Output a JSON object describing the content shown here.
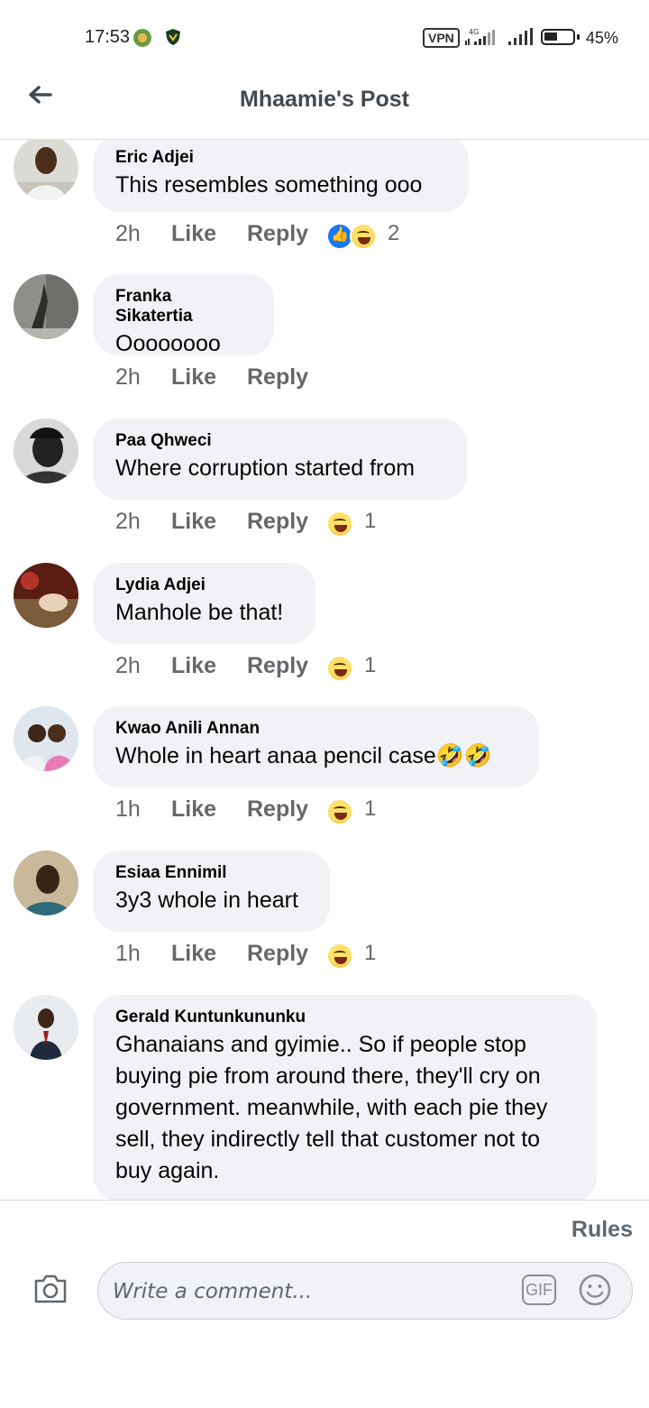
{
  "status_bar": {
    "time": "17:53",
    "vpn": "VPN",
    "network": "4G",
    "battery": "45%",
    "icons": [
      "notification-app-icon",
      "shield-app-icon",
      "vpn-icon",
      "signal-icon",
      "signal-icon",
      "battery-icon"
    ]
  },
  "header": {
    "title": "Mhaamie's Post",
    "back_icon": "arrow-left-icon"
  },
  "comments": [
    {
      "name": "Eric Adjei",
      "text": "This resembles something ooo",
      "time": "2h",
      "like": "Like",
      "reply": "Reply",
      "reactions": [
        "like",
        "haha"
      ],
      "reaction_count": "2"
    },
    {
      "name": "Franka Sikatertia",
      "text": "Oooooooo",
      "time": "2h",
      "like": "Like",
      "reply": "Reply",
      "reactions": [],
      "reaction_count": ""
    },
    {
      "name": "Paa Qhweci",
      "text": "Where corruption started from",
      "time": "2h",
      "like": "Like",
      "reply": "Reply",
      "reactions": [
        "haha"
      ],
      "reaction_count": "1"
    },
    {
      "name": "Lydia Adjei",
      "text": "Manhole be that!",
      "time": "2h",
      "like": "Like",
      "reply": "Reply",
      "reactions": [
        "haha"
      ],
      "reaction_count": "1"
    },
    {
      "name": "Kwao Anili Annan",
      "text": "Whole in heart anaa pencil case🤣🤣",
      "time": "1h",
      "like": "Like",
      "reply": "Reply",
      "reactions": [
        "haha"
      ],
      "reaction_count": "1"
    },
    {
      "name": "Esiaa Ennimil",
      "text": "3y3 whole in heart",
      "time": "1h",
      "like": "Like",
      "reply": "Reply",
      "reactions": [
        "haha"
      ],
      "reaction_count": "1"
    },
    {
      "name": "Gerald Kuntunkununku",
      "text": "Ghanaians and gyimie.. So if people stop buying pie from around there, they'll cry on government. meanwhile, with each pie they sell, they indirectly tell that customer not to buy again.",
      "time": "",
      "like": "",
      "reply": "",
      "reactions": [],
      "reaction_count": ""
    }
  ],
  "footer": {
    "rules": "Rules",
    "placeholder": "Write a comment...",
    "gif": "GIF",
    "camera_icon": "camera-icon",
    "emoji_icon": "smiley-icon"
  },
  "colors": {
    "bubble": "#f0f2f5",
    "secondary_text": "#65676b",
    "like_blue": "#1877f2",
    "haha_yellow": "#f7b126"
  }
}
